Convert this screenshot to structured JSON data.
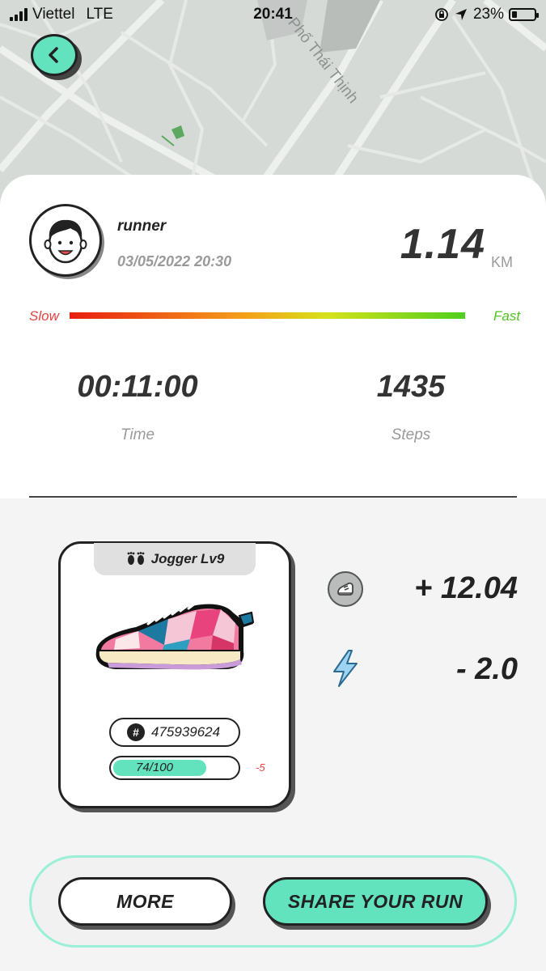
{
  "status_bar": {
    "carrier": "Viettel",
    "network": "LTE",
    "time": "20:41",
    "battery": "23%",
    "battery_level": 0.23
  },
  "map": {
    "street_name": "Phố Thái Thịnh"
  },
  "run": {
    "username": "runner",
    "datetime": "03/05/2022 20:30",
    "distance": "1.14",
    "distance_unit": "KM",
    "pace_slow_label": "Slow",
    "pace_fast_label": "Fast",
    "time_value": "00:11:00",
    "time_label": "Time",
    "steps_value": "1435",
    "steps_label": "Steps"
  },
  "shoe": {
    "level_label": "Jogger Lv9",
    "id": "475939624",
    "durability_text": "74/100",
    "durability_fraction": 0.74,
    "durability_change": "-5"
  },
  "rewards": {
    "token_value": "+ 12.04",
    "energy_value": "- 2.0"
  },
  "actions": {
    "more_label": "MORE",
    "share_label": "SHARE YOUR RUN"
  },
  "colors": {
    "accent": "#62e3bd",
    "slow": "#e34444",
    "fast": "#52c224"
  },
  "icons": [
    "back-arrow-icon",
    "location-arrow-icon",
    "orientation-lock-icon",
    "footprints-icon",
    "hash-icon",
    "sneaker-token-icon",
    "lightning-icon"
  ]
}
